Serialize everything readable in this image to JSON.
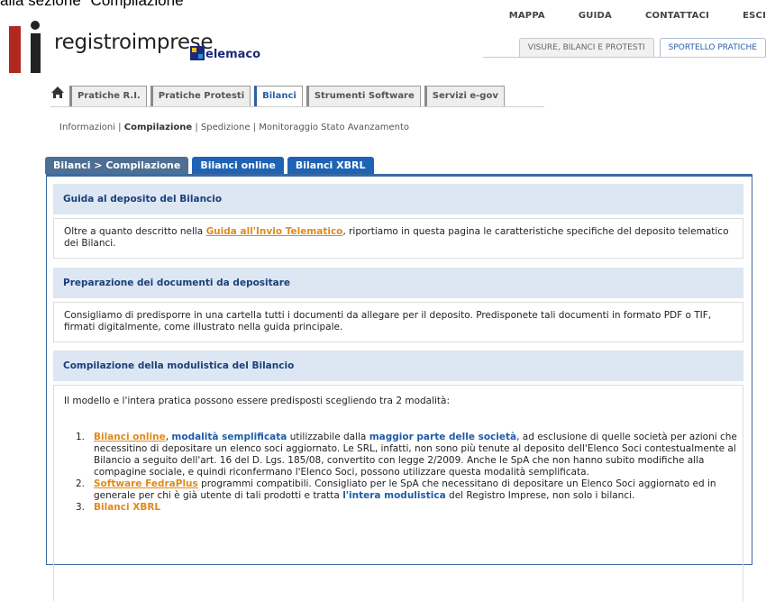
{
  "crop_title": "alla sezione \"Compilazione\"",
  "topnav": [
    "MAPPA",
    "GUIDA",
    "CONTATTACI",
    "ESCI"
  ],
  "logo": {
    "text": "registroimprese",
    "partner": "elemaco"
  },
  "section_tabs": [
    "VISURE, BILANCI E PROTESTI",
    "SPORTELLO PRATICHE"
  ],
  "main_nav": [
    "Pratiche R.I.",
    "Pratiche Protesti",
    "Bilanci",
    "Strumenti Software",
    "Servizi e-gov"
  ],
  "sub_nav": {
    "items": [
      "Informazioni",
      "Compilazione",
      "Spedizione",
      "Monitoraggio Stato Avanzamento"
    ],
    "separator": " | "
  },
  "content_tabs": [
    "Bilanci > Compilazione",
    "Bilanci online",
    "Bilanci XBRL"
  ],
  "sections": [
    {
      "heading": "Guida al deposito del Bilancio",
      "body_pre": "Oltre a quanto descritto nella ",
      "body_link": "Guida all'Invio Telematico",
      "body_post": ", riportiamo in questa pagina le caratteristiche specifiche del deposito telematico dei Bilanci."
    },
    {
      "heading": "Preparazione dei documenti da depositare",
      "body": "Consigliamo di predisporre in una cartella tutti i documenti da allegare per il deposito. Predisponete tali documenti in formato PDF o TIF, firmati digitalmente, come illustrato nella guida principale."
    },
    {
      "heading": "Compilazione della modulistica del Bilancio",
      "body": "Il modello e l'intera pratica possono essere predisposti scegliendo tra 2 modalità:"
    }
  ],
  "list": [
    {
      "num": "1.",
      "link": "Bilanci online",
      "bold1": "modalità semplificata",
      "t1": " utilizzabile dalla ",
      "bold2": "maggior parte delle società",
      "t2": ", ad esclusione di quelle società per azioni che necessitino di depositare un elenco soci aggiornato. Le SRL, infatti, non sono più tenute al deposito dell'Elenco Soci contestualmente al Bilancio a seguito dell'art. 16 del D. Lgs. 185/08, convertito con legge 2/2009. Anche le SpA che non hanno subito modifiche alla compagine sociale, e quindi riconfermano l'Elenco Soci, possono utilizzare questa modalità semplificata."
    },
    {
      "num": "2.",
      "link": "Software FedraPlus",
      "t1": " programmi compatibili. Consigliato per le SpA che necessitano di depositare un Elenco Soci aggiornato ed in generale per chi è già utente di tali prodotti e tratta ",
      "bold1": "l'intera modulistica",
      "t2": " del Registro Imprese, non solo i bilanci."
    },
    {
      "num": "3.",
      "link": "Bilanci XBRL"
    }
  ],
  "colors": {
    "link": "#e08a1a",
    "accent": "#1f63b5",
    "header_bg": "#dce7f3",
    "logo_red": "#b0291f"
  }
}
